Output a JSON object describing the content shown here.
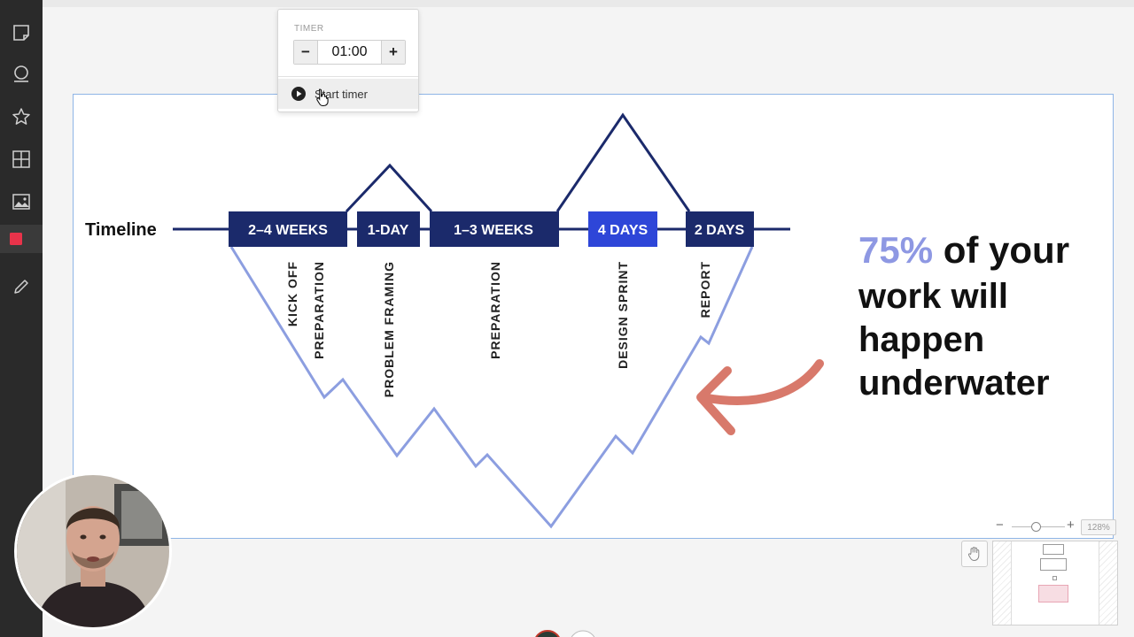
{
  "toolbar": {
    "tools": [
      {
        "name": "sticky-note-icon"
      },
      {
        "name": "comment-icon"
      },
      {
        "name": "star-icon"
      },
      {
        "name": "grid-icon"
      },
      {
        "name": "image-icon"
      },
      {
        "name": "shape-icon",
        "color": "#e8334a"
      },
      {
        "name": "pencil-icon"
      }
    ]
  },
  "timer": {
    "label": "TIMER",
    "value": "01:00",
    "decrement_label": "−",
    "increment_label": "+",
    "start_label": "Start timer"
  },
  "slide": {
    "timeline_label": "Timeline",
    "phases": [
      {
        "label": "2–4 WEEKS",
        "highlighted": false
      },
      {
        "label": "1-DAY",
        "highlighted": false
      },
      {
        "label": "1–3 WEEKS",
        "highlighted": false
      },
      {
        "label": "4 DAYS",
        "highlighted": true
      },
      {
        "label": "2 DAYS",
        "highlighted": false
      }
    ],
    "activities": [
      "KICK OFF",
      "PREPARATION",
      "PROBLEM FRAMING",
      "PREPARATION",
      "DESIGN SPRINT",
      "REPORT"
    ],
    "headline": {
      "highlight": "75%",
      "line1_rest": " of your",
      "line2": "work will",
      "line3": "happen",
      "line4": "underwater"
    },
    "colors": {
      "navy": "#1b2a6b",
      "blue": "#2e46d8",
      "ice": "#8c9ee0",
      "highlight_text": "#8e98e3",
      "arrow": "#d8796b",
      "dark_text": "#111111"
    }
  },
  "zoom": {
    "decrease": "−",
    "increase": "+",
    "percent": "128%",
    "level": 0.45
  }
}
